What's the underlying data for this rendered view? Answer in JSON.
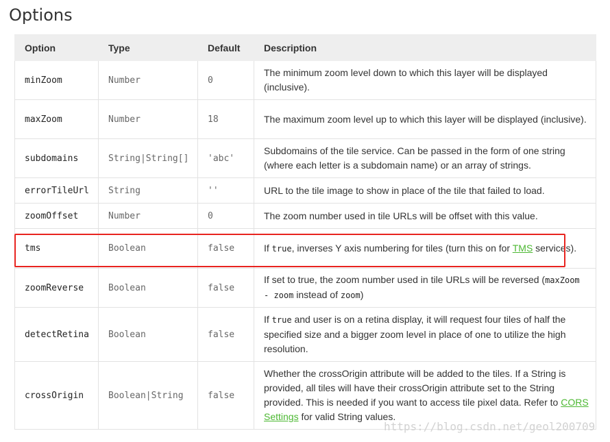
{
  "page": {
    "title": "Options",
    "watermark": "https://blog.csdn.net/geol200709"
  },
  "table": {
    "headers": {
      "option": "Option",
      "type": "Type",
      "default": "Default",
      "description": "Description"
    },
    "rows": [
      {
        "option": "minZoom",
        "type": "Number",
        "default": "0",
        "description": "The minimum zoom level down to which this layer will be displayed (inclusive)."
      },
      {
        "option": "maxZoom",
        "type": "Number",
        "default": "18",
        "description": "The maximum zoom level up to which this layer will be displayed (inclusive)."
      },
      {
        "option": "subdomains",
        "type": "String|String[]",
        "default": "'abc'",
        "description": "Subdomains of the tile service. Can be passed in the form of one string (where each letter is a subdomain name) or an array of strings."
      },
      {
        "option": "errorTileUrl",
        "type": "String",
        "default": "''",
        "description": "URL to the tile image to show in place of the tile that failed to load."
      },
      {
        "option": "zoomOffset",
        "type": "Number",
        "default": "0",
        "description": "The zoom number used in tile URLs will be offset with this value."
      },
      {
        "option": "tms",
        "type": "Boolean",
        "default": "false",
        "desc_parts": {
          "before": "If ",
          "code": "true",
          "middle": ", inverses Y axis numbering for tiles (turn this on for ",
          "link": "TMS",
          "after": " services)."
        }
      },
      {
        "option": "zoomReverse",
        "type": "Boolean",
        "default": "false",
        "desc_parts": {
          "before": "If set to true, the zoom number used in tile URLs will be reversed (",
          "code1": "maxZoom - zoom",
          "middle": " instead of ",
          "code2": "zoom",
          "after": ")"
        }
      },
      {
        "option": "detectRetina",
        "type": "Boolean",
        "default": "false",
        "desc_parts": {
          "before": "If ",
          "code": "true",
          "after": " and user is on a retina display, it will request four tiles of half the specified size and a bigger zoom level in place of one to utilize the high resolution."
        }
      },
      {
        "option": "crossOrigin",
        "type": "Boolean|String",
        "default": "false",
        "desc_parts": {
          "before": "Whether the crossOrigin attribute will be added to the tiles. If a String is provided, all tiles will have their crossOrigin attribute set to the String provided. This is needed if you want to access tile pixel data. Refer to ",
          "link": "CORS Settings",
          "after": " for valid String values."
        }
      }
    ]
  },
  "colors": {
    "highlight": "#e8231f",
    "link": "#4cb832",
    "header_bg": "#eeeeee"
  }
}
